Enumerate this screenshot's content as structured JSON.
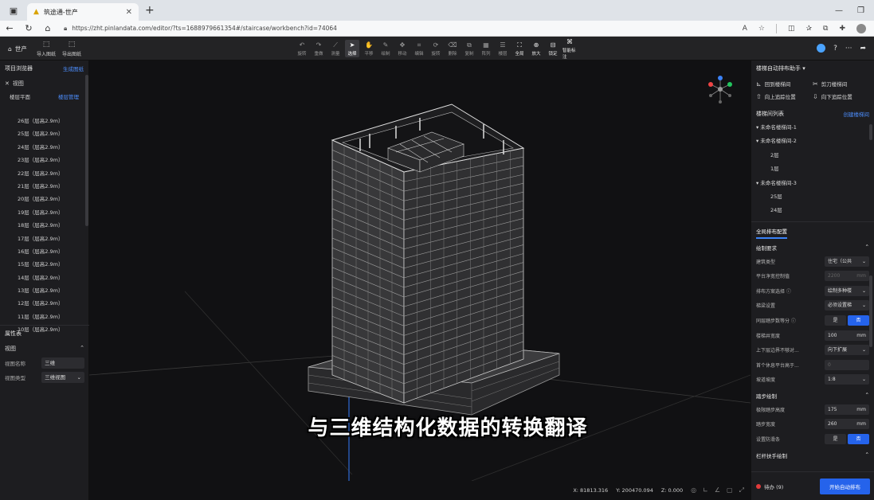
{
  "browser": {
    "tab_title": "筑途通-世产",
    "url": "https://zht.pinlandata.com/editor/?ts=1688979661354#/staircase/workbench?id=74064"
  },
  "topbar": {
    "home_label": "世产",
    "file_buttons": [
      "导入图纸",
      "导出图纸"
    ],
    "tools": [
      "旋转",
      "重做",
      "测量",
      "选择",
      "平移",
      "绘制",
      "移动",
      "编辑",
      "旋转",
      "删除",
      "复制",
      "阵列",
      "楼层",
      "全局",
      "放大",
      "锁定",
      "智能标注"
    ],
    "active_tool_index": 3
  },
  "left_panel": {
    "title": "项目浏览器",
    "title_link": "生成图纸",
    "tree_root": "视图",
    "floor_plan_label": "楼层平面",
    "floor_plan_link": "楼层管理",
    "floors": [
      "26层（层高2.9m）",
      "25层（层高2.9m）",
      "24层（层高2.9m）",
      "23层（层高2.9m）",
      "22层（层高2.9m）",
      "21层（层高2.9m）",
      "20层（层高2.9m）",
      "19层（层高2.9m）",
      "18层（层高2.9m）",
      "17层（层高2.9m）",
      "16层（层高2.9m）",
      "15层（层高2.9m）",
      "14层（层高2.9m）",
      "13层（层高2.9m）",
      "12层（层高2.9m）",
      "11层（层高2.9m）",
      "10层（层高2.9m）"
    ],
    "props_title": "属性表",
    "props_section": "视图",
    "props": [
      {
        "label": "视图名称",
        "value": "三维"
      },
      {
        "label": "视图类型",
        "value": "三维视图"
      }
    ]
  },
  "viewport": {
    "subtitle": "与三维结构化数据的转换翻译",
    "coords": {
      "x": "X: 81813.316",
      "y": "Y: 200470.094",
      "z": "Z: 0.000"
    }
  },
  "right_panel": {
    "title": "楼梯自动排布助手",
    "actions": [
      "回到楼梯间",
      "剪刀楼梯间",
      "向上追踪位置",
      "向下追踪位置"
    ],
    "list_title": "楼梯间列表",
    "list_link": "创建楼梯间",
    "stairs": [
      {
        "label": "未命名楼梯间-1",
        "type": "group"
      },
      {
        "label": "未命名楼梯间-2",
        "type": "group"
      },
      {
        "label": "2层",
        "type": "sub"
      },
      {
        "label": "1层",
        "type": "sub"
      },
      {
        "label": "未命名楼梯间-3",
        "type": "group"
      },
      {
        "label": "25层",
        "type": "sub"
      },
      {
        "label": "24层",
        "type": "sub"
      }
    ],
    "config_tab": "全局排布配置",
    "section1": "绘制要求",
    "fields": [
      {
        "label": "建筑类型",
        "value": "住宅（公共",
        "kind": "select"
      },
      {
        "label": "平台净宽控制值",
        "value": "2200",
        "unit": "mm",
        "kind": "dim"
      },
      {
        "label": "排布方案选择 ⓘ",
        "value": "绘制多种楼",
        "kind": "select"
      },
      {
        "label": "梯梁设置",
        "value": "必须设置梯",
        "kind": "select"
      },
      {
        "label": "同层踏步数等分 ⓘ",
        "yes": "是",
        "no": "否",
        "kind": "yn",
        "selected": "no"
      },
      {
        "label": "楼梯井宽度",
        "value": "100",
        "unit": "mm",
        "kind": "input"
      },
      {
        "label": "上下层边界不够对...",
        "value": "向下扩展",
        "kind": "select"
      },
      {
        "label": "首个休息平台高于...",
        "value": "0",
        "kind": "dim"
      },
      {
        "label": "坡道坡度",
        "value": "1:8",
        "kind": "select"
      }
    ],
    "section2": "踏步绘制",
    "fields2": [
      {
        "label": "极限踏步高度",
        "value": "175",
        "unit": "mm",
        "kind": "input"
      },
      {
        "label": "踏步宽度",
        "value": "260",
        "unit": "mm",
        "kind": "input"
      },
      {
        "label": "设置防滑条",
        "yes": "是",
        "no": "否",
        "kind": "yn",
        "selected": "no"
      }
    ],
    "section3": "栏杆扶手绘制",
    "todo_label": "待办 (9)",
    "start_button": "开始自动排布"
  },
  "colors": {
    "accent": "#2563eb",
    "link": "#4d8fff",
    "panel_bg": "#1d1d20",
    "viewport_bg": "#111113"
  }
}
